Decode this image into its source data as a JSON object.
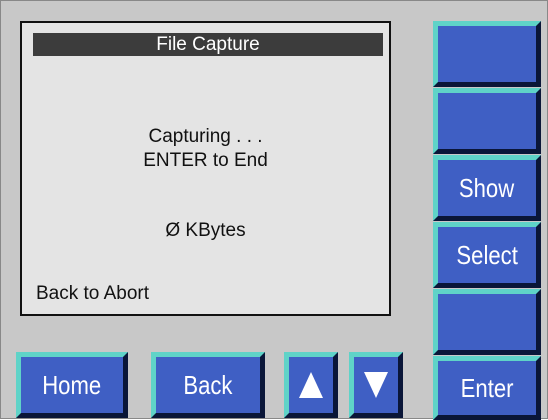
{
  "screen": {
    "title": "File Capture",
    "status_line1": "Capturing . . .",
    "status_line2": "ENTER to End",
    "kbytes": "Ø KBytes",
    "abort_hint": "Back to Abort"
  },
  "side_buttons": {
    "b1_label": "",
    "b2_label": "",
    "show_label": "Show",
    "select_label": "Select",
    "b5_label": "",
    "enter_label": "Enter"
  },
  "bottom_buttons": {
    "home_label": "Home",
    "back_label": "Back",
    "up_icon": "up-arrow-icon",
    "down_icon": "down-arrow-icon"
  },
  "colors": {
    "button_face": "#3f5fc4",
    "button_highlight": "#5fd3c8",
    "button_shadow": "#0a1638",
    "screen_bg": "#e4e4e4",
    "title_bar": "#3c3c3c",
    "panel_bg": "#c8c8c8"
  }
}
